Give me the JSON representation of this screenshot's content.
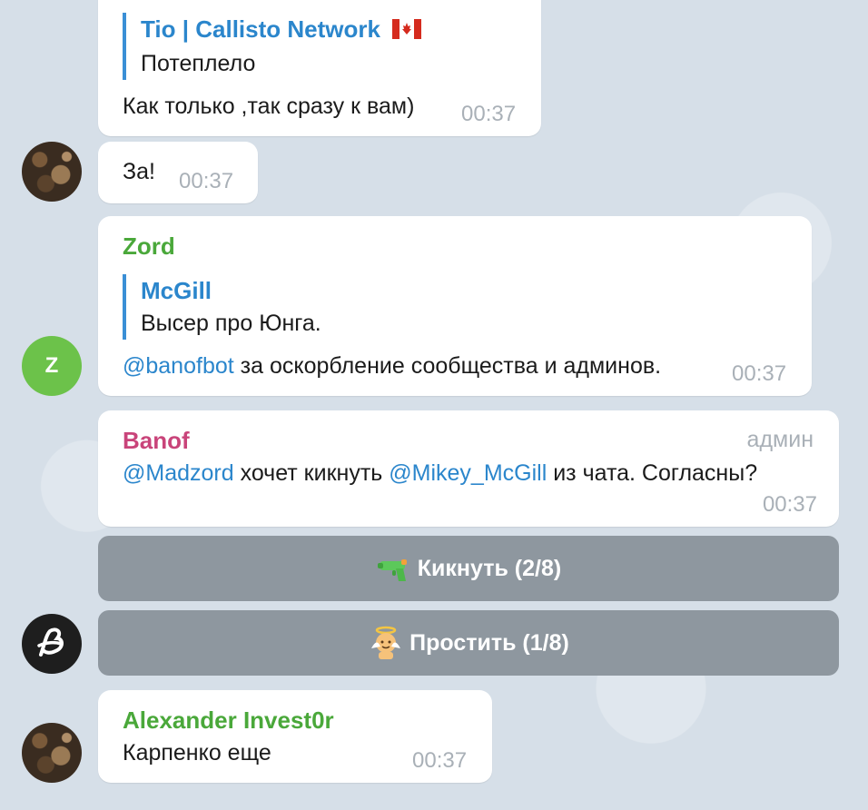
{
  "messages": [
    {
      "quote": {
        "author": "Tio | Callisto Network",
        "flag_icon": "canada-flag",
        "text": "Потеплело"
      },
      "text": "Как только ,так сразу к вам)",
      "time": "00:37"
    },
    {
      "text": "За!",
      "time": "00:37"
    },
    {
      "sender": "Zord",
      "sender_color": "#4aa83a",
      "avatar_letter": "Z",
      "quote": {
        "author": "McGill",
        "text": "Высер про Юнга."
      },
      "mention": "@banofbot",
      "text": " за оскорбление сообщества и админов.",
      "time": "00:37"
    },
    {
      "sender": "Banof",
      "sender_color": "#c9447a",
      "role": "админ",
      "mention1": "@Madzord",
      "text1": " хочет кикнуть ",
      "mention2": "@Mikey_McGill",
      "text2": " из чата. Согласны?",
      "time": "00:37"
    },
    {
      "sender": "Alexander Invest0r",
      "sender_color": "#4aa83a",
      "text": "Карпенко еще",
      "time": "00:37"
    }
  ],
  "buttons": {
    "kick": {
      "label": "Кикнуть (2/8)",
      "icon": "water-pistol-icon"
    },
    "forgive": {
      "label": "Простить (1/8)",
      "icon": "angel-baby-icon"
    }
  },
  "colors": {
    "link": "#2b86cc",
    "button_bg": "#8e979f",
    "time": "#a9b0b7"
  }
}
